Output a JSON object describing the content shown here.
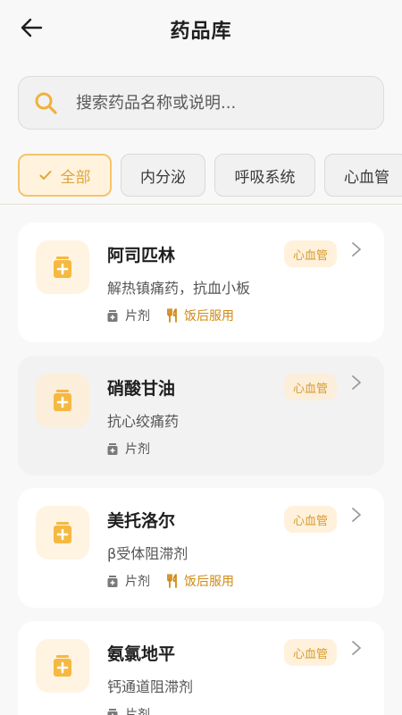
{
  "header": {
    "title": "药品库"
  },
  "search": {
    "placeholder": "搜索药品名称或说明..."
  },
  "filters": [
    {
      "label": "全部",
      "active": true
    },
    {
      "label": "内分泌",
      "active": false
    },
    {
      "label": "呼吸系统",
      "active": false
    },
    {
      "label": "心血管",
      "active": false
    }
  ],
  "drugs": [
    {
      "name": "阿司匹林",
      "description": "解热镇痛药，抗血小板",
      "form": "片剂",
      "instruction": "饭后服用",
      "category": "心血管"
    },
    {
      "name": "硝酸甘油",
      "description": "抗心绞痛药",
      "form": "片剂",
      "instruction": "",
      "category": "心血管"
    },
    {
      "name": "美托洛尔",
      "description": "β受体阻滞剂",
      "form": "片剂",
      "instruction": "饭后服用",
      "category": "心血管"
    },
    {
      "name": "氨氯地平",
      "description": "钙通道阻滞剂",
      "form": "片剂",
      "instruction": "",
      "category": "心血管"
    }
  ],
  "colors": {
    "accent": "#f5b942",
    "accentText": "#d99b2b",
    "tagBg": "#fff1dc",
    "mealText": "#d08a16"
  },
  "icons": {
    "back": "arrow-left-icon",
    "search": "magnifier-icon",
    "drug": "medicine-bottle-icon",
    "form": "pill-box-icon",
    "meal": "fork-knife-icon",
    "chevron": "chevron-right-icon",
    "check": "check-icon"
  }
}
